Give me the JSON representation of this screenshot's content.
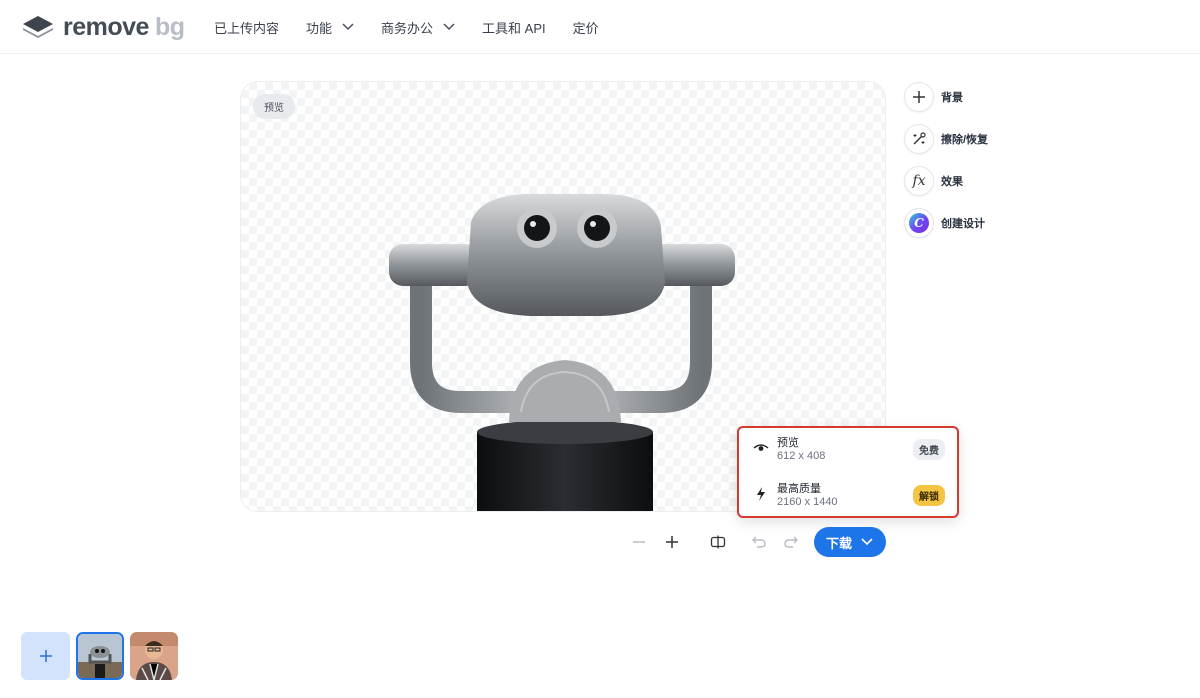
{
  "header": {
    "logo": {
      "word1": "remove",
      "word2": "bg"
    },
    "nav": [
      {
        "label": "已上传内容",
        "has_dropdown": false
      },
      {
        "label": "功能",
        "has_dropdown": true
      },
      {
        "label": "商务办公",
        "has_dropdown": true
      },
      {
        "label": "工具和 API",
        "has_dropdown": false
      },
      {
        "label": "定价",
        "has_dropdown": false
      }
    ]
  },
  "canvas": {
    "preview_label": "预览",
    "subject_icon": "coin-operated-binocular-viewer-image"
  },
  "side_tools": [
    {
      "label": "背景",
      "icon": "plus-icon"
    },
    {
      "label": "擦除/恢复",
      "icon": "magic-brush-icon"
    },
    {
      "label": "效果",
      "icon": "fx-icon",
      "icon_text": "fx"
    },
    {
      "label": "创建设计",
      "icon": "canva-icon",
      "icon_text": "C"
    }
  ],
  "download_menu": {
    "options": [
      {
        "title": "预览",
        "resolution": "612 x 408",
        "badge": "免费",
        "icon": "eye-icon"
      },
      {
        "title": "最高质量",
        "resolution": "2160 x 1440",
        "badge": "解锁",
        "icon": "bolt-icon"
      }
    ]
  },
  "toolbar": {
    "download_label": "下载",
    "buttons": [
      "zoom-out-icon",
      "zoom-in-icon",
      "compare-icon",
      "undo-icon",
      "redo-icon"
    ]
  },
  "thumbnails": {
    "add_icon": "plus-icon",
    "items": [
      "binocular-viewer-thumbnail",
      "person-portrait-thumbnail"
    ]
  },
  "colors": {
    "accent": "#1e74e9",
    "highlight_border": "#d33c2c",
    "unlock_badge": "#f6c443",
    "upload_bg": "#d3e3fb"
  }
}
